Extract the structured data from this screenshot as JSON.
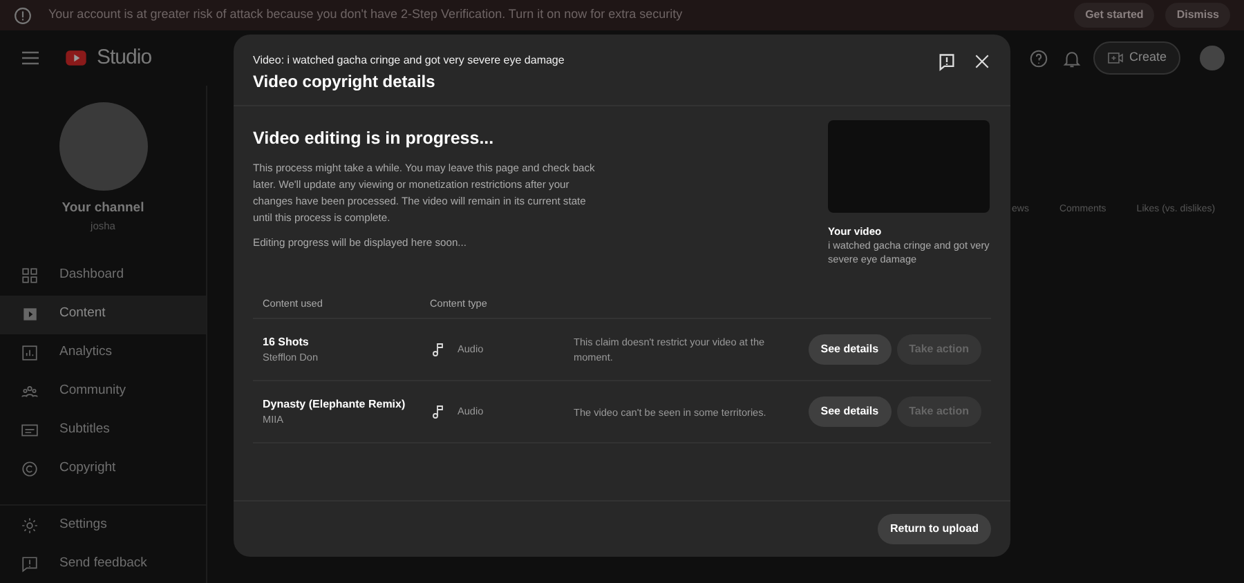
{
  "banner": {
    "message": "Your account is at greater risk of attack because you don't have 2-Step Verification. Turn it on now for extra security",
    "buttons": [
      "Get started",
      "Dismiss"
    ]
  },
  "header": {
    "logo": "Studio",
    "create": "Create"
  },
  "sidebar": {
    "channel_label": "Your channel",
    "channel_name": "josha",
    "items": [
      {
        "label": "Dashboard",
        "selected": false
      },
      {
        "label": "Content",
        "selected": true
      },
      {
        "label": "Analytics",
        "selected": false
      },
      {
        "label": "Community",
        "selected": false
      },
      {
        "label": "Subtitles",
        "selected": false
      },
      {
        "label": "Copyright",
        "selected": false
      }
    ],
    "footer_items": [
      {
        "label": "Settings"
      },
      {
        "label": "Send feedback"
      }
    ]
  },
  "background_columns": [
    "ews",
    "Comments",
    "Likes (vs. dislikes)"
  ],
  "dialog": {
    "subtitle": "Video: i watched gacha cringe and got very severe eye damage",
    "title": "Video copyright details",
    "heading": "Video editing is in progress...",
    "paragraphs": [
      "This process might take a while. You may leave this page and check back later. We'll update any viewing or monetization restrictions after your changes have been processed. The video will remain in its current state until this process is complete.",
      "Editing progress will be displayed here soon..."
    ],
    "video_label": "Your video",
    "video_title": "i watched gacha cringe and got very severe eye damage",
    "columns": [
      "Content used",
      "Content type"
    ],
    "rows": [
      {
        "title": "16 Shots",
        "artist": "Stefflon Don",
        "type": "Audio",
        "impact": "This claim doesn't restrict your video at the moment.",
        "buttons": [
          {
            "label": "See details",
            "disabled": false
          },
          {
            "label": "Take action",
            "disabled": true
          }
        ]
      },
      {
        "title": "Dynasty (Elephante Remix)",
        "artist": "MIIA",
        "type": "Audio",
        "impact": "The video can't be seen in some territories.",
        "buttons": [
          {
            "label": "See details",
            "disabled": false
          },
          {
            "label": "Take action",
            "disabled": true
          }
        ]
      }
    ],
    "footer_button": "Return to upload"
  }
}
